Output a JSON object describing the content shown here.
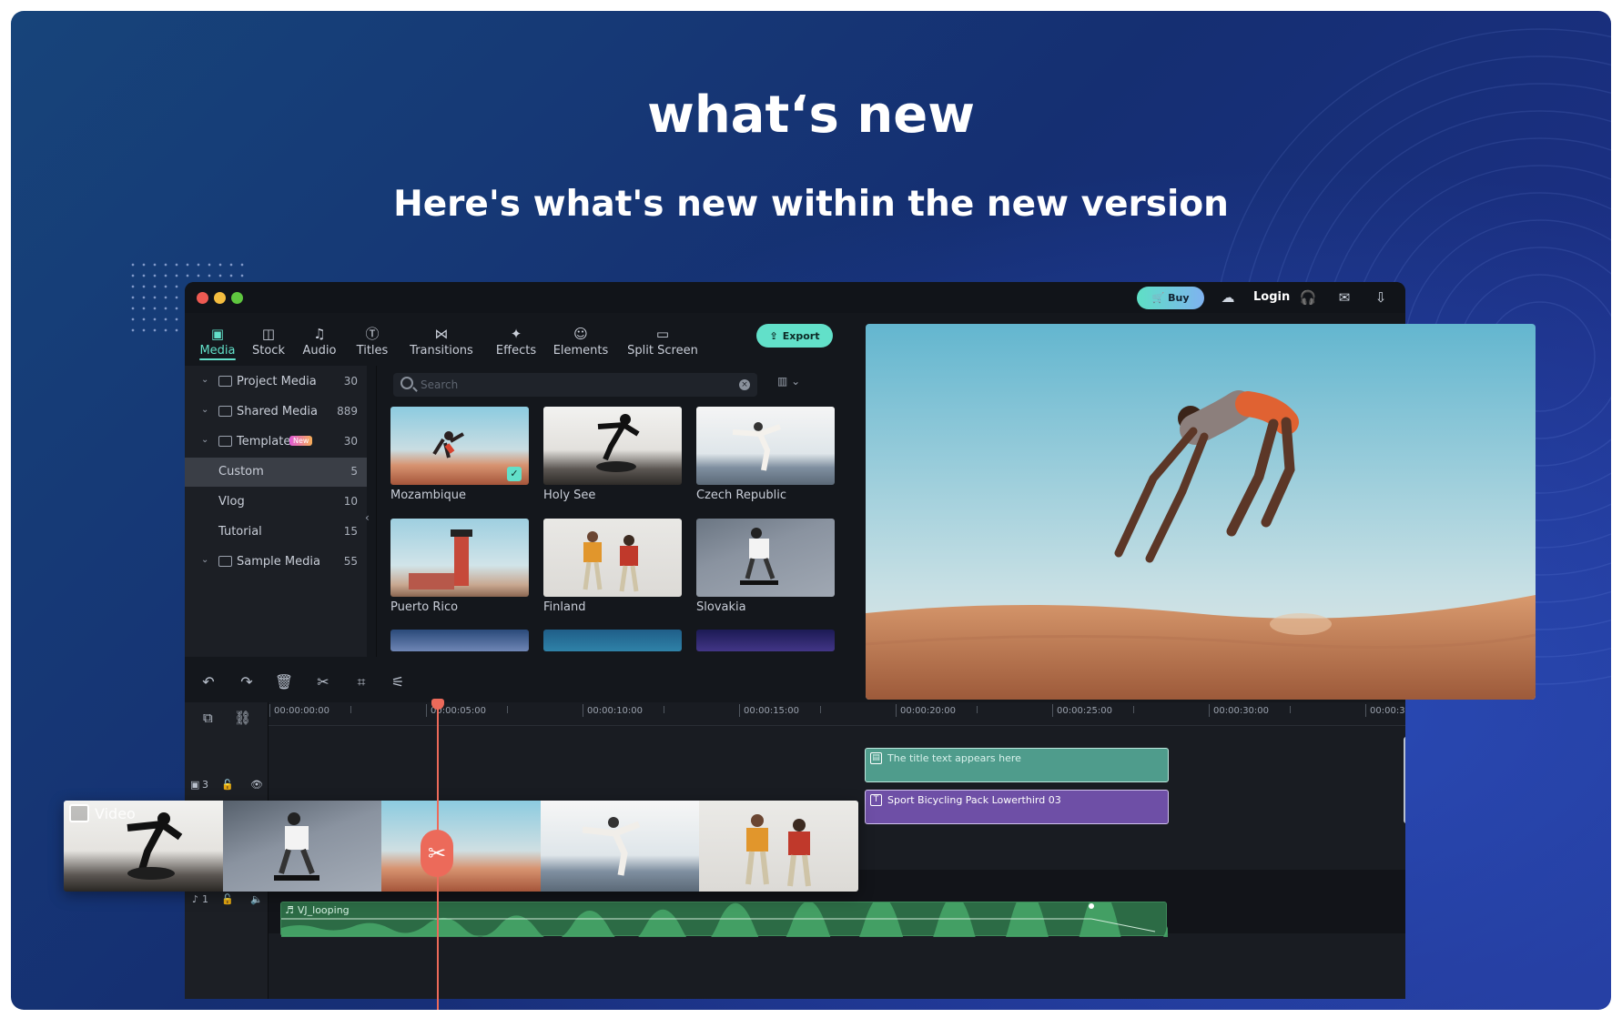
{
  "hero": {
    "title": "what‘s new",
    "subtitle": "Here's what's new within the new version"
  },
  "window": {
    "buy_label": "Buy",
    "login_label": "Login",
    "icons": [
      "cart-icon",
      "cloud-icon",
      "headset-icon",
      "mail-icon",
      "download-icon"
    ]
  },
  "tabs": [
    {
      "label": "Media",
      "icon": "media-icon",
      "active": true
    },
    {
      "label": "Stock",
      "icon": "stock-icon"
    },
    {
      "label": "Audio",
      "icon": "audio-icon"
    },
    {
      "label": "Titles",
      "icon": "titles-icon"
    },
    {
      "label": "Transitions",
      "icon": "transitions-icon"
    },
    {
      "label": "Effects",
      "icon": "effects-icon"
    },
    {
      "label": "Elements",
      "icon": "elements-icon"
    },
    {
      "label": "Split Screen",
      "icon": "split-screen-icon"
    }
  ],
  "export_label": "Export",
  "sidebar": {
    "items": [
      {
        "label": "Project Media",
        "count": "30",
        "folder": true
      },
      {
        "label": "Shared Media",
        "count": "889",
        "folder": true
      },
      {
        "label": "Template",
        "count": "30",
        "folder": true,
        "badge": "New"
      },
      {
        "label": "Custom",
        "count": "5",
        "selected": true
      },
      {
        "label": "Vlog",
        "count": "10"
      },
      {
        "label": "Tutorial",
        "count": "15"
      },
      {
        "label": "Sample Media",
        "count": "55",
        "folder": true
      }
    ]
  },
  "search": {
    "placeholder": "Search"
  },
  "media": [
    {
      "label": "Mozambique",
      "checked": true
    },
    {
      "label": "Holy See"
    },
    {
      "label": "Czech Republic"
    },
    {
      "label": "Puerto Rico"
    },
    {
      "label": "Finland"
    },
    {
      "label": "Slovakia"
    }
  ],
  "timeline": {
    "ruler": [
      "00:00:00:00",
      "00:00:05:00",
      "00:00:10:00",
      "00:00:15:00",
      "00:00:20:00",
      "00:00:25:00",
      "00:00:30:00",
      "00:00:3"
    ],
    "title_clip": "The title text appears here",
    "lower_clip": "Sport Bicycling Pack Lowerthird 03",
    "video_label": "Video",
    "audio_label": "VJ_looping",
    "video_track_num": "3",
    "audio_track_num": "1"
  },
  "colors": {
    "accent": "#62e0c9",
    "playhead": "#ec6a5a",
    "title_clip": "#4f9c8c",
    "lower_clip": "#6e4fa6",
    "audio_clip": "#2c6b45"
  }
}
